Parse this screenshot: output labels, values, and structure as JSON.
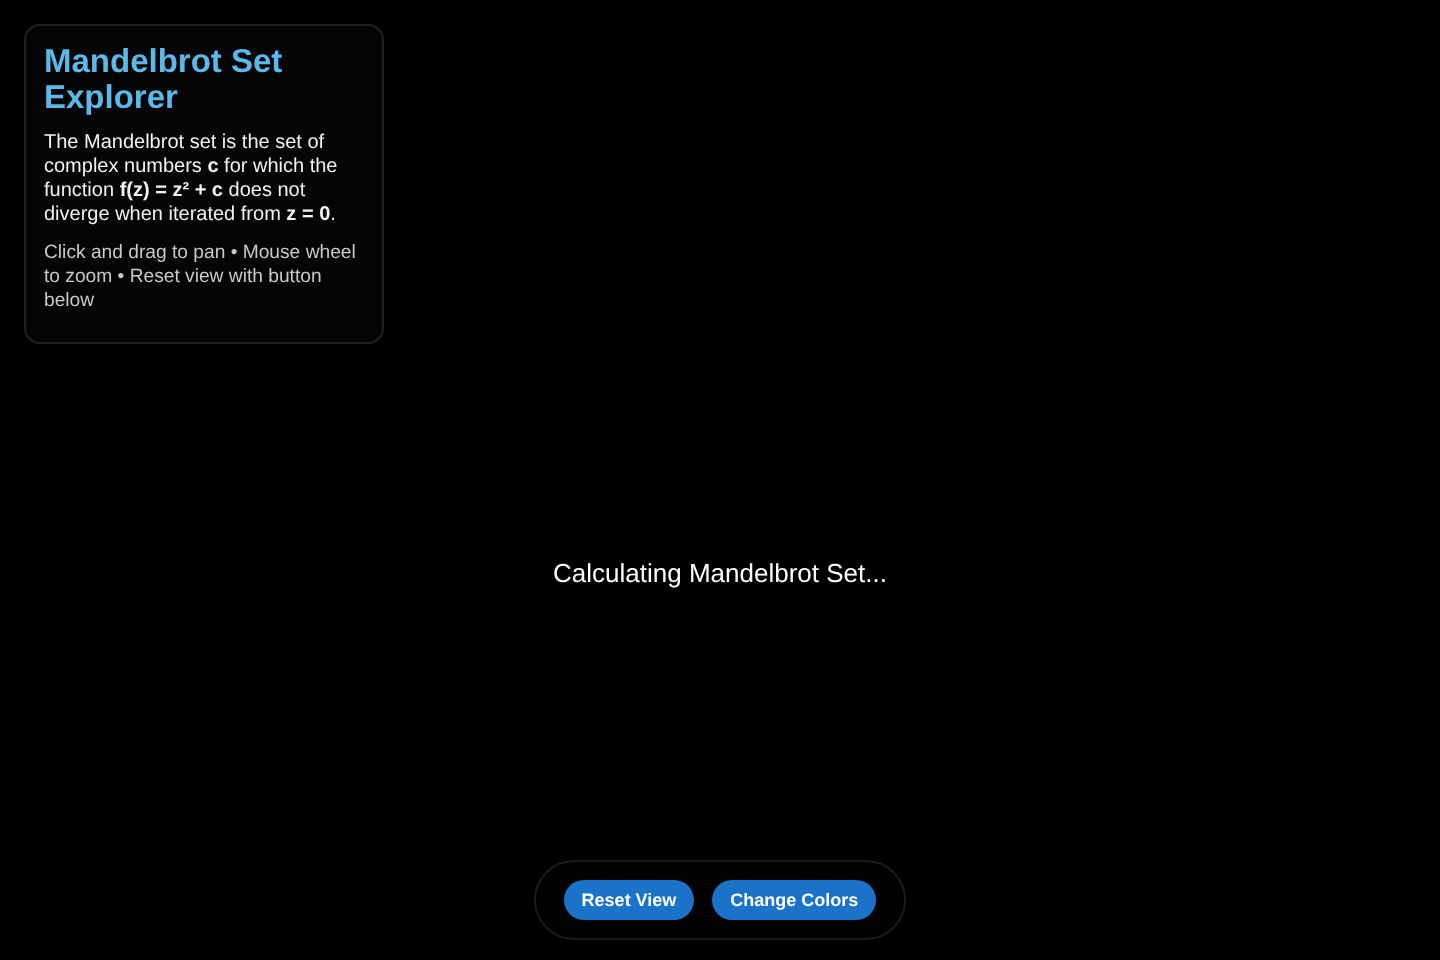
{
  "info_panel": {
    "title": "Mandelbrot Set Explorer",
    "description": "The Mandelbrot set is the set of complex numbers **c** for which the function **f(z) = z²** **+ c** does not diverge when iterated from **z** **= 0**.",
    "hint": "Click and drag to pan • Mouse wheel to zoom • Reset view with button below"
  },
  "status": "Calculating Mandelbrot Set...",
  "buttons": [
    "Reset View",
    "Change Colors"
  ]
}
